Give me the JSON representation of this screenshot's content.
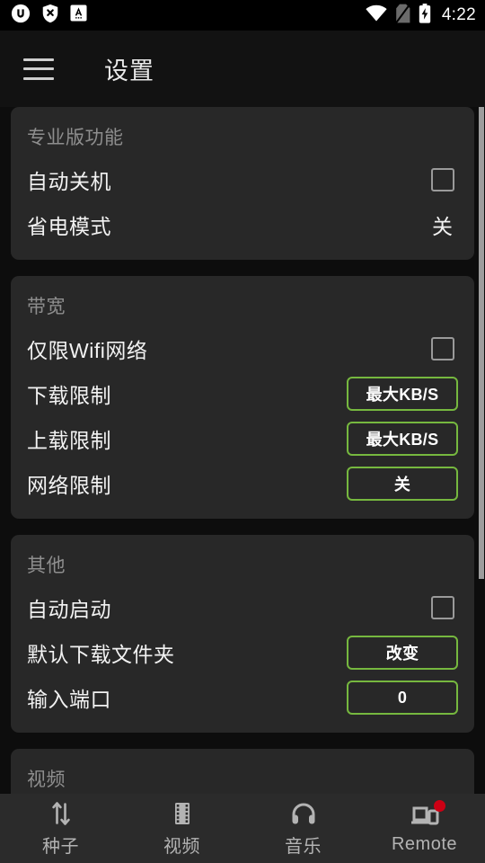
{
  "statusbar": {
    "icons": [
      "utorrent-icon",
      "shield-x-icon",
      "a-badge-icon"
    ],
    "right_icons": [
      "wifi-icon",
      "no-sim-icon",
      "battery-charging-icon"
    ],
    "time": "4:22"
  },
  "appbar": {
    "menu_icon": "hamburger-menu-icon",
    "title": "设置"
  },
  "cards": [
    {
      "title": "专业版功能",
      "rows": [
        {
          "label": "自动关机",
          "control": "checkbox",
          "checked": false
        },
        {
          "label": "省电模式",
          "control": "text",
          "value": "关"
        }
      ]
    },
    {
      "title": "带宽",
      "rows": [
        {
          "label": "仅限Wifi网络",
          "control": "checkbox",
          "checked": false
        },
        {
          "label": "下载限制",
          "control": "button",
          "value": "最大KB/S"
        },
        {
          "label": "上载限制",
          "control": "button",
          "value": "最大KB/S"
        },
        {
          "label": "网络限制",
          "control": "button",
          "value": "关"
        }
      ]
    },
    {
      "title": "其他",
      "rows": [
        {
          "label": "自动启动",
          "control": "checkbox",
          "checked": false
        },
        {
          "label": "默认下载文件夹",
          "control": "button",
          "value": "改变"
        },
        {
          "label": "输入端口",
          "control": "button",
          "value": "0"
        }
      ]
    },
    {
      "title": "视频",
      "rows": []
    }
  ],
  "bottomnav": [
    {
      "label": "种子",
      "icon": "transfer-arrows-icon",
      "badge": false
    },
    {
      "label": "视频",
      "icon": "film-strip-icon",
      "badge": false
    },
    {
      "label": "音乐",
      "icon": "headphones-icon",
      "badge": false
    },
    {
      "label": "Remote",
      "icon": "remote-cast-icon",
      "badge": true
    }
  ],
  "colors": {
    "accent_green": "#76b83f",
    "badge_red": "#cc0014",
    "card_bg": "#282828",
    "page_bg": "#0d0d0d"
  }
}
